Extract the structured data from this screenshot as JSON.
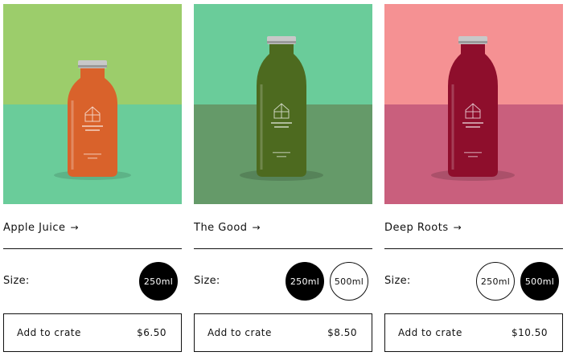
{
  "size_label": "Size:",
  "add_label": "Add to crate",
  "products": [
    {
      "name": "Apple Juice",
      "arrow": "→",
      "price": "$6.50",
      "bg_top": "#9ccd6b",
      "bg_bottom": "#6acc9a",
      "juice_color": "#d9622b",
      "sizes": [
        {
          "label": "250ml",
          "selected": true
        }
      ]
    },
    {
      "name": "The Good",
      "arrow": "→",
      "price": "$8.50",
      "bg_top": "#6acc9a",
      "bg_bottom": "#659a69",
      "juice_color": "#4d6a1f",
      "sizes": [
        {
          "label": "250ml",
          "selected": true
        },
        {
          "label": "500ml",
          "selected": false
        }
      ]
    },
    {
      "name": "Deep Roots",
      "arrow": "→",
      "price": "$10.50",
      "bg_top": "#f59193",
      "bg_bottom": "#c95f7d",
      "juice_color": "#8e0e2c",
      "sizes": [
        {
          "label": "250ml",
          "selected": false
        },
        {
          "label": "500ml",
          "selected": true
        }
      ]
    }
  ]
}
